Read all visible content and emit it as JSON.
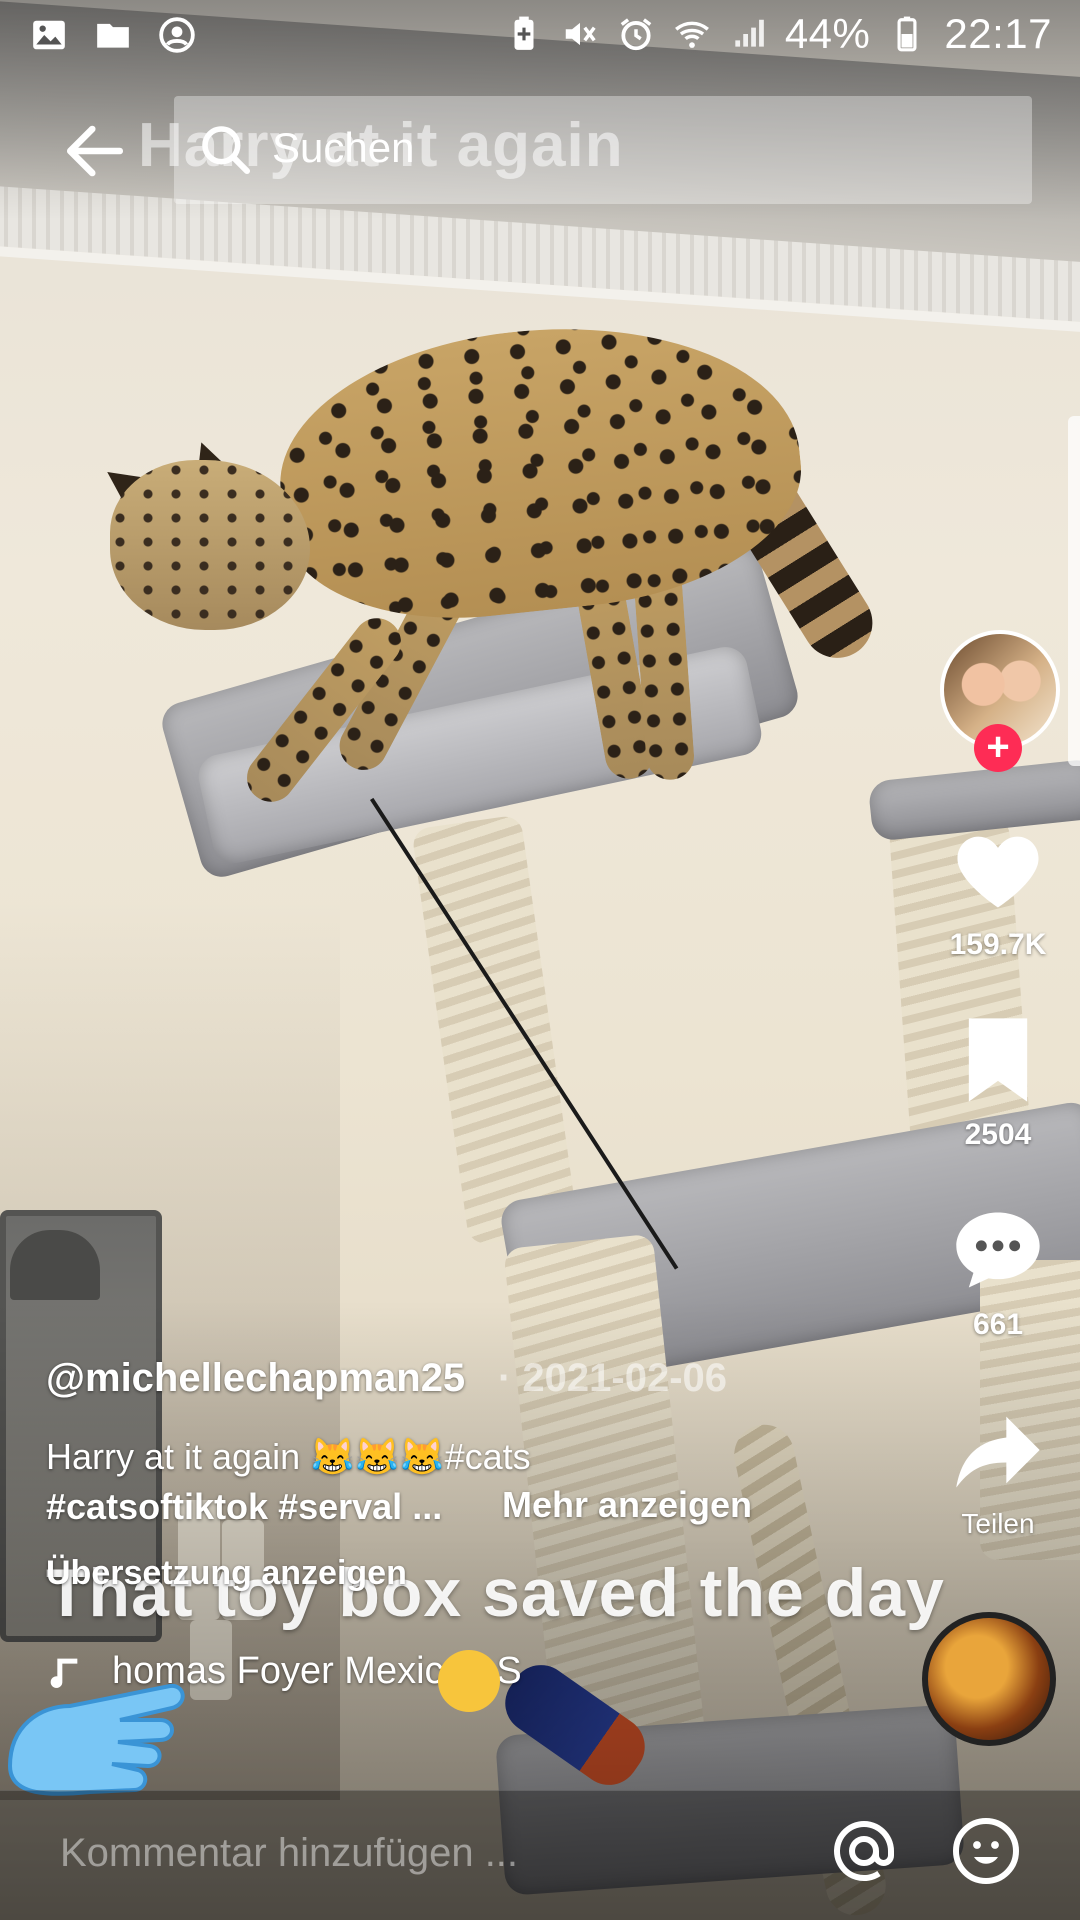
{
  "status_bar": {
    "battery_percent": "44%",
    "clock": "22:17",
    "left_icons": [
      "gallery-icon",
      "folder-icon",
      "account-circle-icon"
    ],
    "right_icons": [
      "battery-saver-icon",
      "mute-icon",
      "alarm-icon",
      "wifi-icon",
      "signal-icon",
      "battery-icon"
    ]
  },
  "header": {
    "search_placeholder": "Suchen",
    "video_title_overlay": "Harry at it again"
  },
  "post": {
    "username": "@michellechapman25",
    "date": "· 2021-02-06",
    "caption_line1": "Harry at it again 😹😹😹#cats",
    "caption_line2": "#catsoftiktok #serval ...",
    "more_label": "Mehr anzeigen",
    "burned_caption": "That toy box saved the day",
    "translate_label": "Übersetzung anzeigen",
    "music_title": "homas Foyer     Mexican S"
  },
  "actions": {
    "likes": "159.7K",
    "favorites": "2504",
    "comments": "661",
    "share_label": "Teilen"
  },
  "comment_bar": {
    "placeholder": "Kommentar hinzufügen ..."
  },
  "colors": {
    "follow_accent": "#fe2c55",
    "text": "#ffffff"
  }
}
